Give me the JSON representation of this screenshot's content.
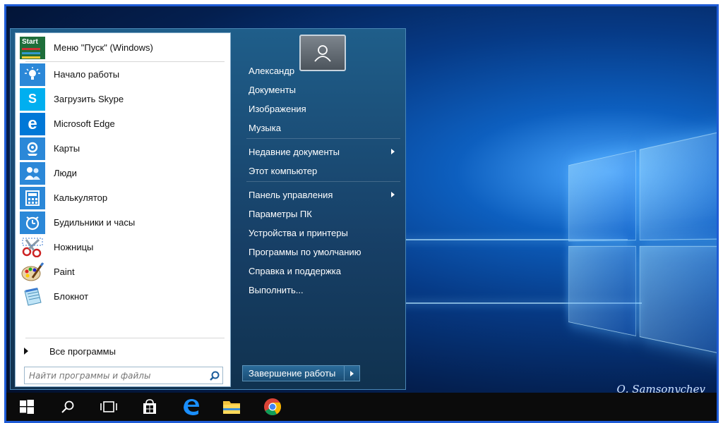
{
  "start_menu": {
    "pinned_header": {
      "label": "Меню \"Пуск\" (Windows)",
      "icon": "start-menu-icon",
      "icon_text": "Start"
    },
    "apps": [
      {
        "label": "Начало работы",
        "icon": "lightbulb-icon"
      },
      {
        "label": "Загрузить Skype",
        "icon": "skype-icon",
        "icon_text": "S"
      },
      {
        "label": "Microsoft Edge",
        "icon": "edge-icon",
        "icon_text": "e"
      },
      {
        "label": "Карты",
        "icon": "maps-icon"
      },
      {
        "label": "Люди",
        "icon": "people-icon"
      },
      {
        "label": "Калькулятор",
        "icon": "calculator-icon"
      },
      {
        "label": "Будильники и часы",
        "icon": "alarm-clock-icon"
      },
      {
        "label": "Ножницы",
        "icon": "snipping-tool-icon"
      },
      {
        "label": "Paint",
        "icon": "paint-icon"
      },
      {
        "label": "Блокнот",
        "icon": "notepad-icon"
      }
    ],
    "all_programs": "Все программы",
    "search_placeholder": "Найти программы и файлы",
    "right_items": [
      {
        "label": "Александр",
        "submenu": false
      },
      {
        "label": "Документы",
        "submenu": false
      },
      {
        "label": "Изображения",
        "submenu": false
      },
      {
        "label": "Музыка",
        "submenu": false
      },
      {
        "label": "Недавние документы",
        "submenu": true
      },
      {
        "label": "Этот компьютер",
        "submenu": false
      },
      {
        "label": "Панель управления",
        "submenu": true
      },
      {
        "label": "Параметры ПК",
        "submenu": false
      },
      {
        "label": "Устройства и принтеры",
        "submenu": false
      },
      {
        "label": "Программы по умолчанию",
        "submenu": false
      },
      {
        "label": "Справка и поддержка",
        "submenu": false
      },
      {
        "label": "Выполнить...",
        "submenu": false
      }
    ],
    "shutdown_label": "Завершение работы"
  },
  "watermark": "О. Samsonychev",
  "taskbar": {
    "items": [
      "windows-start-icon",
      "search-icon",
      "task-view-icon",
      "store-icon",
      "edge-icon",
      "file-explorer-icon",
      "chrome-icon"
    ]
  },
  "colors": {
    "menu_bg": "#173f66",
    "accent": "#1e5bd6",
    "skype": "#00aff0",
    "edge": "#0078d7",
    "tile_blue": "#2b88d8"
  }
}
